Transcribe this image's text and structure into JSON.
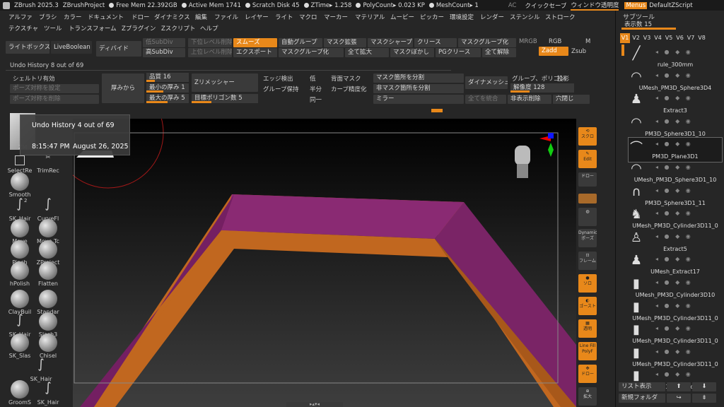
{
  "titlebar": {
    "app": "ZBrush 2025.3",
    "project": "ZBrushProject",
    "free_mem": "Free Mem 22.392GB",
    "active_mem": "Active Mem 1741",
    "scratch": "Scratch Disk 45",
    "ztime": "ZTime▸ 1.258",
    "polycount": "PolyCount▸ 0.023 KP",
    "meshcount": "MeshCount▸ 1",
    "ac": "AC",
    "quicksave": "クイックセーブ",
    "window_transparency": "ウィンドウ透明度",
    "menus": "Menus",
    "zscript": "DefaultZScript"
  },
  "menubar": {
    "row1": [
      "アルファ",
      "ブラシ",
      "カラー",
      "ドキュメント",
      "ドロー",
      "ダイナミクス",
      "編集",
      "ファイル",
      "レイヤー",
      "ライト",
      "マクロ",
      "マーカー",
      "マテリアル",
      "ムービー",
      "ピッカー",
      "環境設定",
      "レンダー",
      "ステンシル",
      "ストローク"
    ],
    "row2": [
      "テクスチャ",
      "ツール",
      "トランスフォーム",
      "Zプラグイン",
      "Zスクリプト",
      "ヘルプ"
    ]
  },
  "shelf": {
    "lightbox": "ライトボックス",
    "liveboolean": "LiveBoolean",
    "divide": "ディバイド",
    "lowsubdiv": "低SubDiv",
    "highsubdiv": "高SubDiv",
    "lowerlevel_del": "下位レベル削除",
    "upperlevel_del": "上位レベル削除",
    "smooth": "スムーズ",
    "autogroup": "自動グループ",
    "mask_expand": "マスク拡張",
    "mask_sharpen": "マスクシャープ",
    "crease": "クリース",
    "mask_group": "マスクグループ化",
    "mrgb": "MRGB",
    "rgb": "RGB",
    "m": "M",
    "export": "エクスポート",
    "mask_group2": "マスクグループ化",
    "expand_all": "全て拡大",
    "mask_blur": "マスクぼかし",
    "pgcrease": "PGクリース",
    "uncrease_all": "全て解除",
    "zadd": "Zadd",
    "zsub": "Zsub"
  },
  "undo_header": "Undo History 8 out of 69",
  "panel": {
    "shell": "シェルトリ有効",
    "pose_symm": "ポーズ対称を設定",
    "pose_symm_del": "ポーズ対称を削除",
    "thickness": "厚みから",
    "quality_label": "品質",
    "quality_value": "16",
    "quality_frac": 0.2,
    "min_thick_label": "最小の厚み",
    "min_thick_value": "1",
    "min_thick_frac": 0.4,
    "max_thick_label": "最大の厚み",
    "max_thick_value": "5",
    "max_thick_frac": 0.5,
    "zremesher": "Zリメッシャー",
    "target_poly_label": "目標ポリゴン数",
    "target_poly_value": "5",
    "target_poly_frac": 0.3,
    "edge_detect": "エッジ検出",
    "group_keep": "グループ保持",
    "low": "低",
    "half": "半分",
    "same": "同一",
    "backface_mask": "背面マスク",
    "curve_strength": "カーブ精度化",
    "split_mask": "マスク箇所を分割",
    "split_unmask": "非マスク箇所を分割",
    "mirror": "ミラー",
    "dynamesh": "ダイナメッシュ",
    "group_poly": "グループ、ポリゴン",
    "projection": "投影",
    "resolution_label": "解像度",
    "resolution_value": "128",
    "resolution_frac": 0.3,
    "merge_all": "全てを統合",
    "hidden_del": "非表示削除",
    "close_holes": "穴閉じ"
  },
  "tooltip": {
    "title": "Undo History 4 out of 69",
    "time": "8:15:47 PM",
    "date": "August 26, 2025"
  },
  "left_tools": {
    "selectrect": "SelectRe",
    "trimrect": "TrimRec",
    "smooth": "Smooth",
    "sk_hair": "SK_Hair",
    "curvefl": "CurveFl",
    "move": "Move",
    "move_tc": "Move Tc",
    "pinch": "Pinch",
    "zproject": "ZProject",
    "hpolish": "hPolish",
    "flatten": "Flatten",
    "claybuild": "ClayBuil",
    "standard": "Standar",
    "sk_hair2": "SK_Hair",
    "slash3": "Slash3",
    "sk_slash": "SK_Slas",
    "chisel": "Chisel",
    "sk_hair3": "SK_Hair",
    "groom": "GroomS",
    "sk_hair4": "SK_Hair",
    "zm": "ZM",
    "badge2": "2"
  },
  "right_tools": {
    "scroll": "スクロ",
    "edit": "Edit",
    "draw": "ドロー",
    "persp": "パース",
    "floor": "フロア",
    "dynamic": "Dynamic",
    "pose": "ポーズ",
    "frame": "フレーム",
    "solo": "ソロ",
    "ghost": "ゴースト",
    "transp": "透明",
    "polyf": "PolyF",
    "line_fill": "Line Fill",
    "move": "ドロー",
    "zoom": "拡大"
  },
  "subtool": {
    "title": "サブツール",
    "display_count_label": "表示数",
    "display_count_value": "15",
    "display_frac": 0.55,
    "versions": [
      "V1",
      "V2",
      "V3",
      "V4",
      "V5",
      "V6",
      "V7",
      "V8"
    ],
    "items": [
      "rule_300mm",
      "UMesh_PM3D_Sphere3D4",
      "Extract3",
      "PM3D_Sphere3D1_10",
      "PM3D_Plane3D1",
      "UMesh_PM3D_Sphere3D1_10",
      "PM3D_Sphere3D1_11",
      "UMesh_PM3D_Cylinder3D11_0",
      "Extract5",
      "UMesh_Extract17",
      "UMesh_PM3D_Cylinder3D10",
      "UMesh_PM3D_Cylinder3D11_0",
      "UMesh_PM3D_Cylinder3D11_0",
      "UMesh_PM3D_Cylinder3D11_0",
      "UMesh_PM3D_Cylinder3D11"
    ],
    "list_display": "リスト表示",
    "new_folder": "新規フォルダ"
  },
  "colors": {
    "accent": "#e8881a",
    "frame_top": "#8a2a73",
    "frame_side": "#b6621e"
  }
}
